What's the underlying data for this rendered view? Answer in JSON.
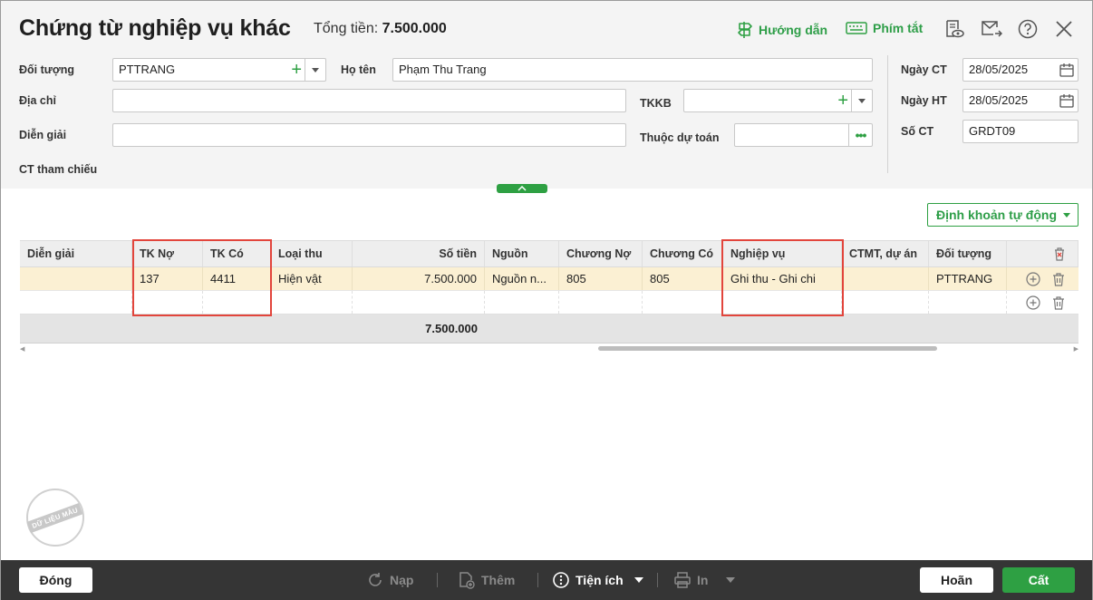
{
  "header": {
    "title": "Chứng từ nghiệp vụ khác",
    "total_label": "Tổng tiền:",
    "total_value": "7.500.000",
    "guide_label": "Hướng dẫn",
    "shortcut_label": "Phím tắt"
  },
  "form": {
    "doi_tuong_label": "Đối tượng",
    "doi_tuong_value": "PTTRANG",
    "ho_ten_label": "Họ tên",
    "ho_ten_value": "Phạm Thu Trang",
    "dia_chi_label": "Địa chỉ",
    "dia_chi_value": "",
    "tkkb_label": "TKKB",
    "tkkb_value": "",
    "dien_giai_label": "Diễn giải",
    "dien_giai_value": "",
    "thuoc_du_toan_label": "Thuộc dự toán",
    "thuoc_du_toan_value": "",
    "ct_tham_chieu_label": "CT tham chiếu",
    "ngay_ct_label": "Ngày CT",
    "ngay_ct_value": "28/05/2025",
    "ngay_ht_label": "Ngày HT",
    "ngay_ht_value": "28/05/2025",
    "so_ct_label": "Số CT",
    "so_ct_value": "GRDT09"
  },
  "auto_button": "Định khoản tự động",
  "grid": {
    "columns": [
      "Diễn giải",
      "TK Nợ",
      "TK Có",
      "Loại thu",
      "Số tiền",
      "Nguồn",
      "Chương Nợ",
      "Chương Có",
      "Nghiệp vụ",
      "CTMT, dự án",
      "Đối tượng"
    ],
    "row1": {
      "dien_giai": "",
      "tk_no": "137",
      "tk_co": "4411",
      "loai_thu": "Hiện vật",
      "so_tien": "7.500.000",
      "nguon": "Nguồn n...",
      "chuong_no": "805",
      "chuong_co": "805",
      "nghiep_vu": "Ghi thu - Ghi chi",
      "ctmt": "",
      "doi_tuong": "PTTRANG"
    },
    "total": "7.500.000"
  },
  "stamp_text": "DỮ LIỆU MẪU",
  "footer": {
    "close": "Đóng",
    "reload": "Nạp",
    "add": "Thêm",
    "utilities": "Tiện ích",
    "print": "In",
    "cancel": "Hoãn",
    "save": "Cất"
  },
  "colors": {
    "accent": "#2ea043",
    "highlight": "#e2453c",
    "selected_row": "#fbf0d3",
    "footer_bg": "#353535"
  }
}
